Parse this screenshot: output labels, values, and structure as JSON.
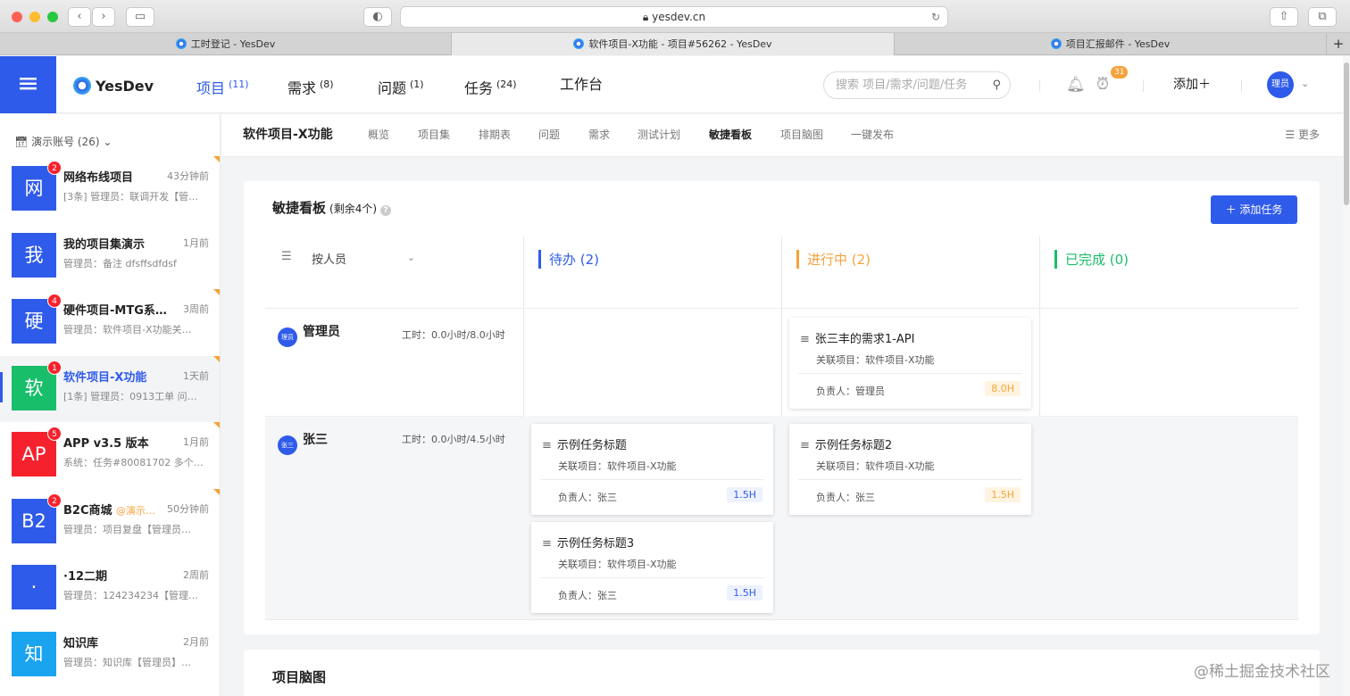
{
  "browser": {
    "url": "yesdev.cn",
    "tabs": [
      {
        "label": "工时登记 - YesDev"
      },
      {
        "label": "软件项目-X功能 - 项目#56262 - YesDev"
      },
      {
        "label": "项目汇报邮件 - YesDev"
      }
    ],
    "new_tab": "+"
  },
  "header": {
    "logo": "YesDev",
    "nav": [
      {
        "label": "项目",
        "count": "(11)"
      },
      {
        "label": "需求",
        "count": "(8)"
      },
      {
        "label": "问题",
        "count": "(1)"
      },
      {
        "label": "任务",
        "count": "(24)"
      },
      {
        "label": "工作台",
        "count": ""
      }
    ],
    "search_placeholder": "搜索 项目/需求/问题/任务",
    "notify_count": "31",
    "add_label": "添加＋",
    "avatar": "理员"
  },
  "sidebar": {
    "account": "演示账号 (26)",
    "projects": [
      {
        "avatar": "网",
        "badge": "2",
        "name": "网络布线项目",
        "mention": "",
        "time": "43分钟前",
        "desc": "[3条] 管理员：联调开发【管…",
        "color": "#2f5bea"
      },
      {
        "avatar": "我",
        "badge": "",
        "name": "我的项目集演示",
        "mention": "",
        "time": "1月前",
        "desc": "管理员：备注 dfsffsdfdsf",
        "color": "#2f5bea"
      },
      {
        "avatar": "硬",
        "badge": "4",
        "name": "硬件项目-MTG系…",
        "mention": "",
        "time": "3周前",
        "desc": "管理员：软件项目-X功能关…",
        "color": "#2f5bea"
      },
      {
        "avatar": "软",
        "badge": "1",
        "name": "软件项目-X功能",
        "mention": "",
        "time": "1天前",
        "desc": "[1条] 管理员：0913工单 问…",
        "color": "#19be6b"
      },
      {
        "avatar": "AP",
        "badge": "5",
        "name": "APP v3.5 版本",
        "mention": "",
        "time": "1月前",
        "desc": "系统：任务#80081702 多个…",
        "color": "#f5222d"
      },
      {
        "avatar": "B2",
        "badge": "2",
        "name": "B2C商城",
        "mention": "@演示…",
        "time": "50分钟前",
        "desc": "管理员：项目复盘【管理员…",
        "color": "#2f5bea"
      },
      {
        "avatar": "·",
        "badge": "",
        "name": "·12二期",
        "mention": "",
        "time": "2周前",
        "desc": "管理员：124234234【管理…",
        "color": "#2f5bea"
      },
      {
        "avatar": "知",
        "badge": "",
        "name": "知识库",
        "mention": "",
        "time": "2月前",
        "desc": "管理员：知识库【管理员】…",
        "color": "#1aa4f0"
      }
    ]
  },
  "subnav": {
    "title": "软件项目-X功能",
    "tabs": [
      "概览",
      "项目集",
      "排期表",
      "问题",
      "需求",
      "测试计划",
      "敏捷看板",
      "项目脑图",
      "一键发布"
    ],
    "active": "敏捷看板",
    "more": "更多"
  },
  "board": {
    "title": "敏捷看板",
    "remaining": "(剩余4个)",
    "help": "?",
    "add_task": "＋ 添加任务",
    "group_by": "按人员",
    "columns": [
      {
        "label": "待办 (2)",
        "color": "#2f5bea"
      },
      {
        "label": "进行中 (2)",
        "color": "#f7a23a"
      },
      {
        "label": "已完成 (0)",
        "color": "#19be6b"
      }
    ],
    "lanes": [
      {
        "avatar": "理员",
        "name": "管理员",
        "hours": "工时：0.0小时/8.0小时"
      },
      {
        "avatar": "张三",
        "name": "张三",
        "hours": "工时：0.0小时/4.5小时"
      }
    ],
    "tasks": [
      {
        "title": "张三丰的需求1-API",
        "project": "关联项目：软件项目-X功能",
        "owner": "负责人：管理员",
        "hours": "8.0H"
      },
      {
        "title": "示例任务标题",
        "project": "关联项目：软件项目-X功能",
        "owner": "负责人：张三",
        "hours": "1.5H"
      },
      {
        "title": "示例任务标题2",
        "project": "关联项目：软件项目-X功能",
        "owner": "负责人：张三",
        "hours": "1.5H"
      },
      {
        "title": "示例任务标题3",
        "project": "关联项目：软件项目-X功能",
        "owner": "负责人：张三",
        "hours": "1.5H"
      }
    ]
  },
  "mindmap": {
    "title": "项目脑图"
  },
  "corner_watermark": "@稀土掘金技术社区"
}
